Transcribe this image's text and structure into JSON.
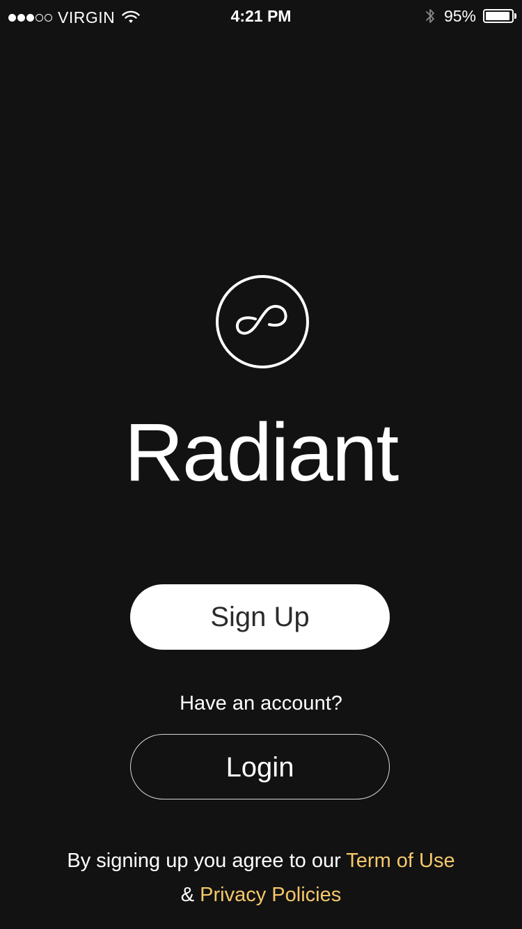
{
  "status_bar": {
    "carrier": "VIRGIN",
    "signal_bars_filled": 3,
    "signal_bars_total": 5,
    "time": "4:21 PM",
    "battery_percent": "95%",
    "battery_level": 0.95,
    "icons": [
      "signal-dots-icon",
      "wifi-icon",
      "bluetooth-icon",
      "battery-icon"
    ]
  },
  "app": {
    "logo_icon": "infinity-loop-icon",
    "title": "Radiant"
  },
  "actions": {
    "signup_label": "Sign Up",
    "have_account_text": "Have an account?",
    "login_label": "Login"
  },
  "legal": {
    "prefix": "By signing up you agree to our",
    "terms_link": "Term of Use",
    "and_text": "&",
    "privacy_link": "Privacy Policies"
  },
  "colors": {
    "background": "#121212",
    "text": "#ffffff",
    "accent_link": "#f6c86a",
    "signup_button_bg": "#ffffff",
    "signup_button_text": "#2b2b2b"
  }
}
